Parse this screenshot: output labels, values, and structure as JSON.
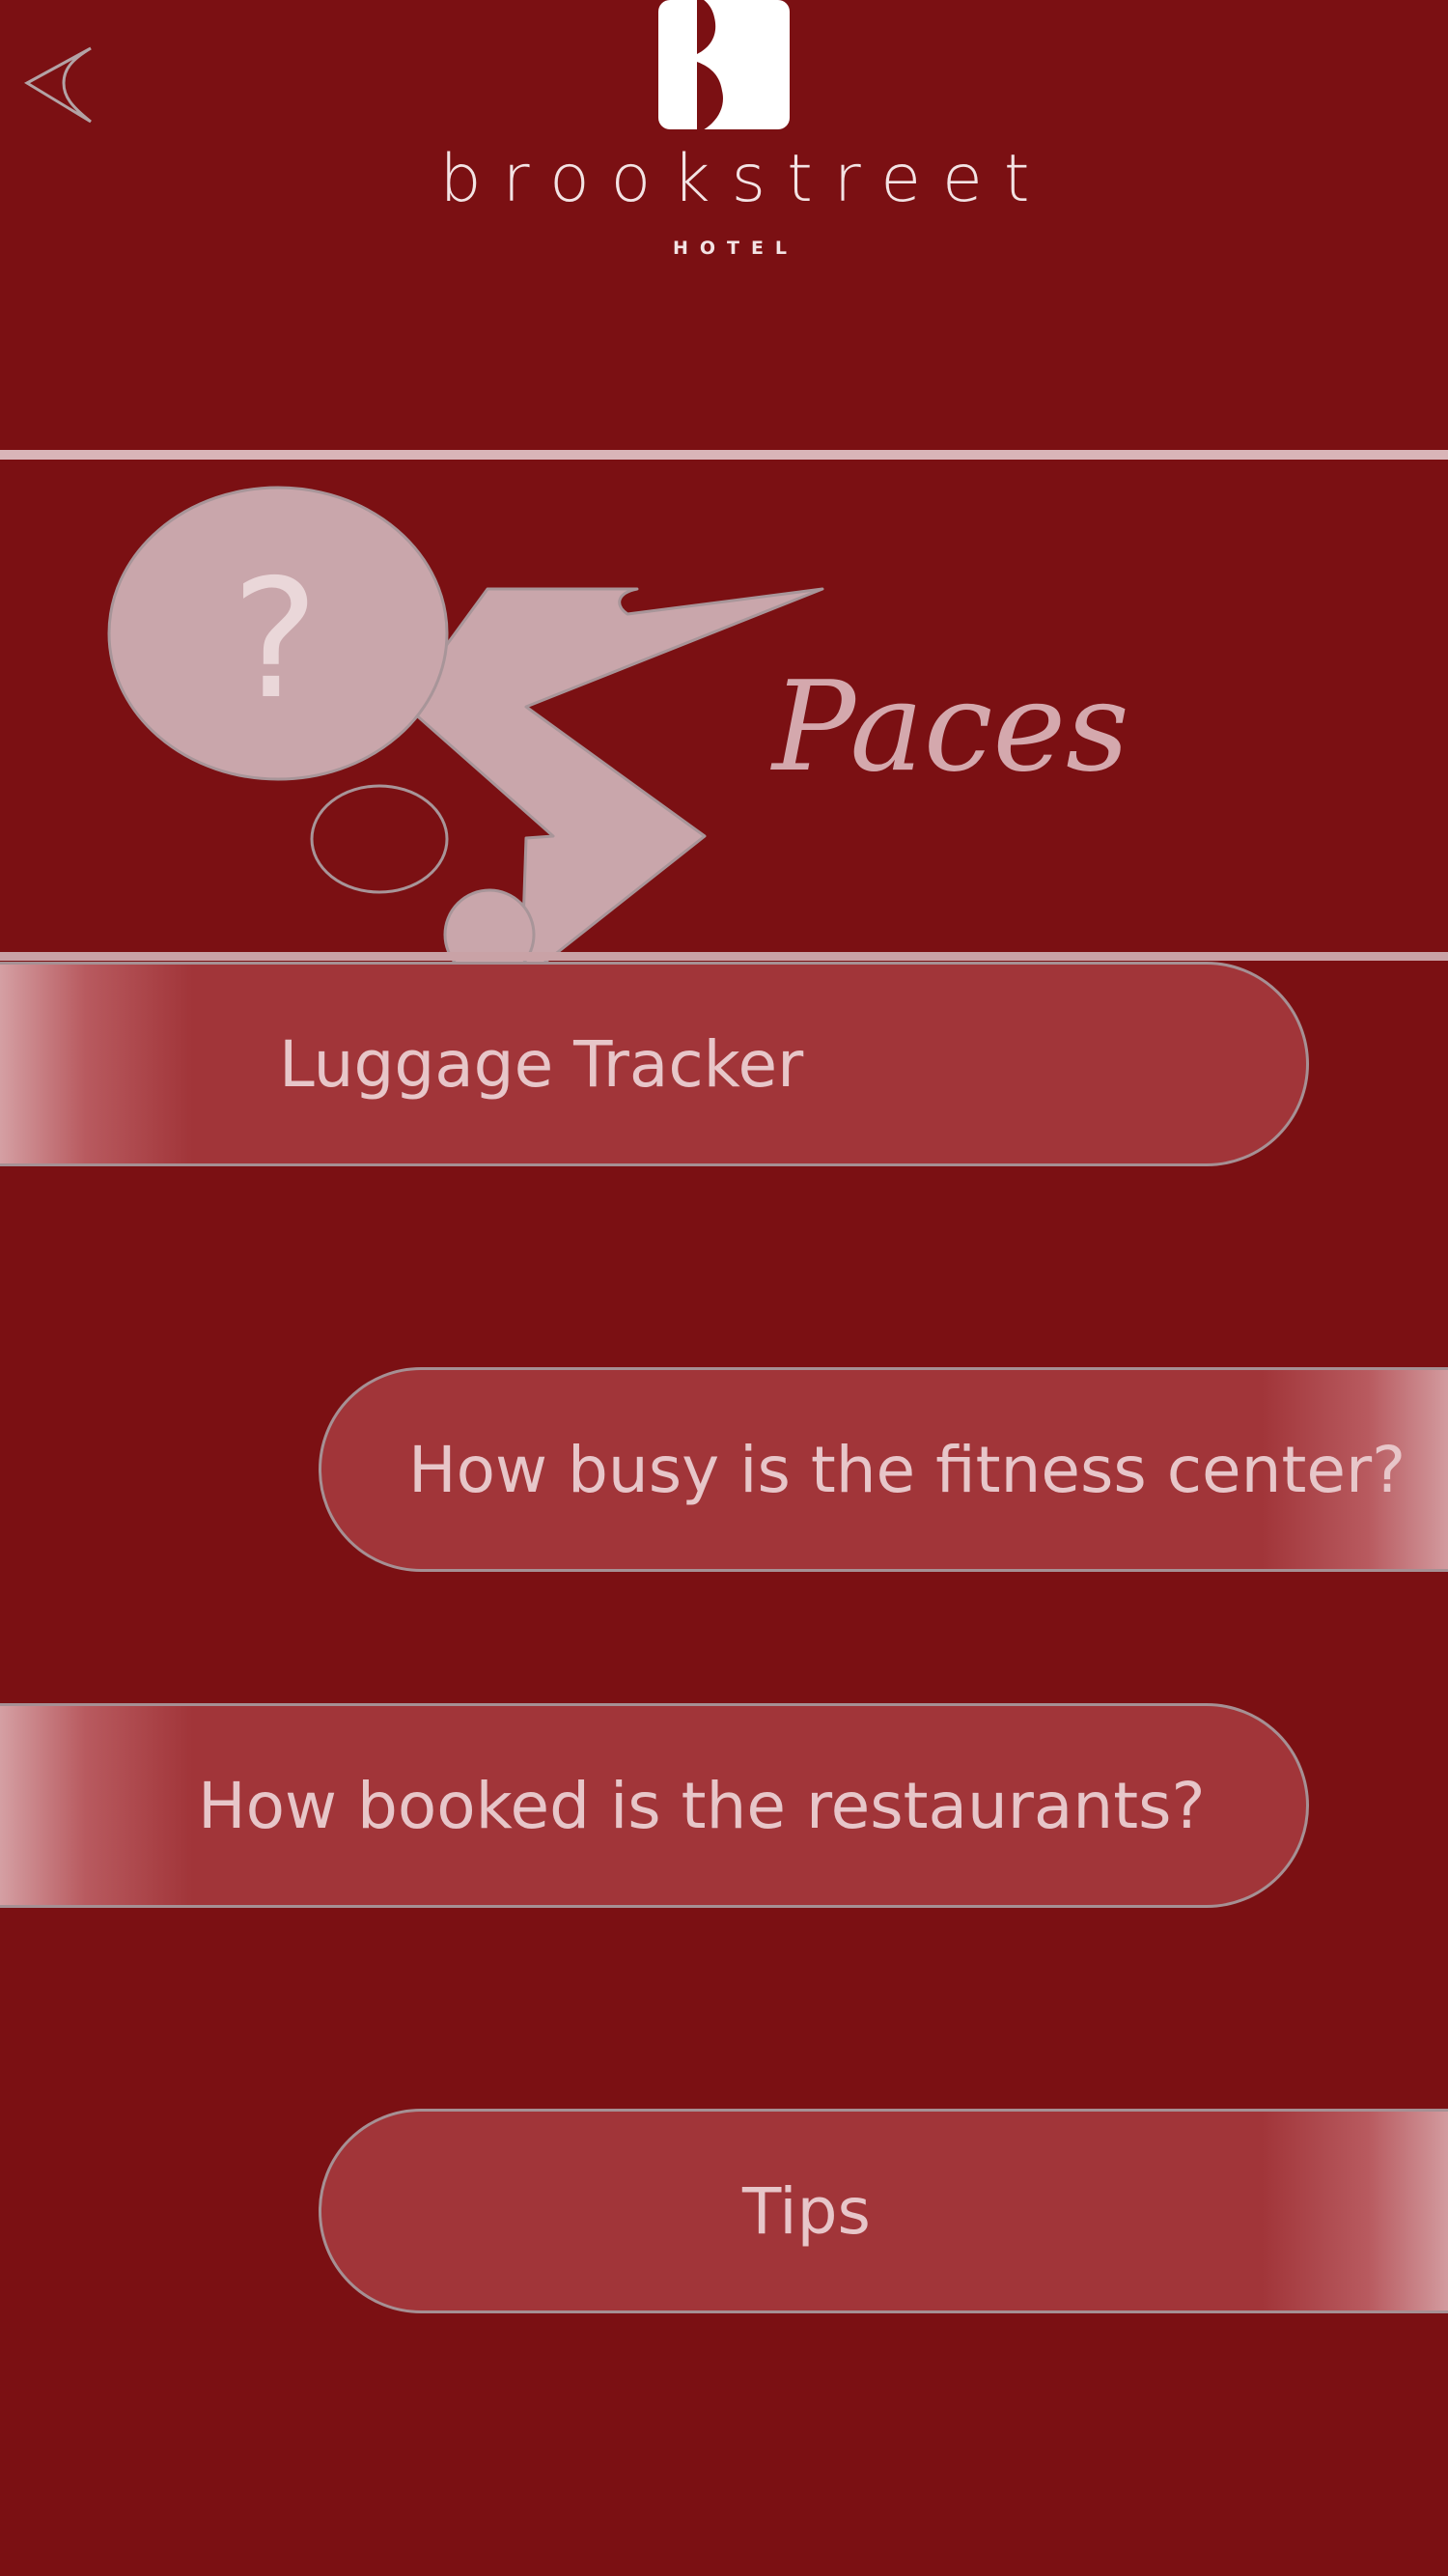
{
  "header": {
    "back_icon": "back-arrow-icon",
    "brand_name": "brookstreet",
    "brand_sub": "HOTEL"
  },
  "banner": {
    "title": "Paces",
    "question_glyph": "?"
  },
  "menu": {
    "items": [
      {
        "label": "Luggage Tracker"
      },
      {
        "label": "How busy is the fitness center?"
      },
      {
        "label": "How booked is the restaurants?"
      },
      {
        "label": "Tips"
      }
    ]
  },
  "colors": {
    "background": "#7b1013",
    "button_fill": "#a13539",
    "button_text": "#e7c6c9",
    "divider": "#d9b5b8",
    "accent_light": "#d4a8ad"
  }
}
